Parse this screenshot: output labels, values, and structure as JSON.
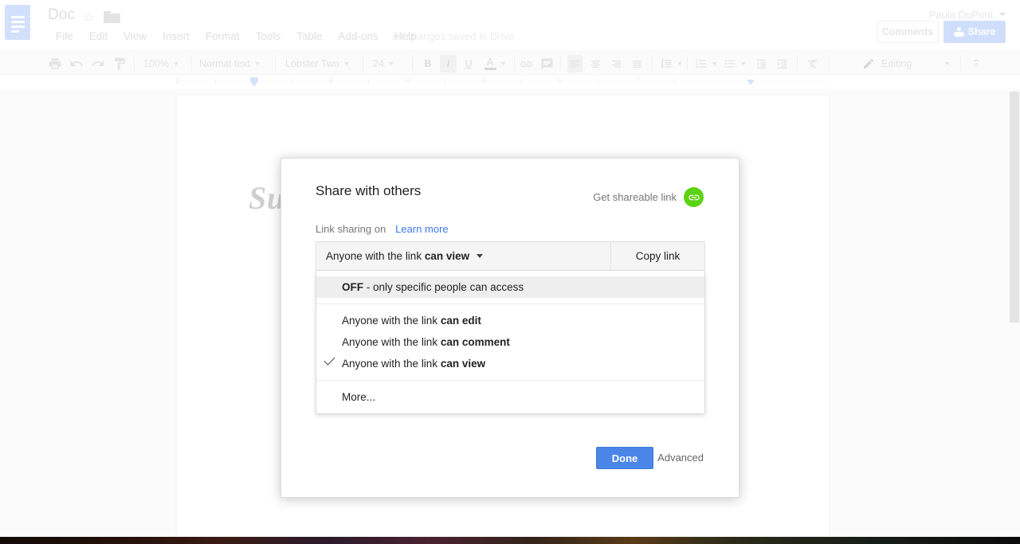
{
  "app": {
    "doc_title": "Doc",
    "account_name": "Paula DuPont",
    "save_status": "All changes saved in Drive",
    "comments_label": "Comments",
    "share_label": "Share"
  },
  "menubar": {
    "items": [
      "File",
      "Edit",
      "View",
      "Insert",
      "Format",
      "Tools",
      "Table",
      "Add-ons",
      "Help"
    ]
  },
  "toolbar": {
    "zoom": "100%",
    "style": "Normal text",
    "font": "Lobster Two",
    "font_size": "24",
    "bold": "B",
    "italic": "I",
    "underline": "U",
    "text_color": "A",
    "mode": "Editing"
  },
  "ruler": {
    "numbers": [
      "1",
      "2",
      "3",
      "4",
      "5",
      "6",
      "7"
    ]
  },
  "document": {
    "heading_visible_text": "Su"
  },
  "modal": {
    "title": "Share with others",
    "get_shareable_link": "Get shareable link",
    "link_sharing_label": "Link sharing on",
    "learn_more": "Learn more",
    "selected_option_prefix": "Anyone with the link ",
    "selected_option_strong": "can view",
    "copy_link": "Copy link",
    "done": "Done",
    "advanced": "Advanced",
    "dropdown": {
      "groups": [
        {
          "items": [
            {
              "strong": "OFF",
              "rest": " - only specific people can access",
              "checked": false,
              "highlighted": true
            }
          ]
        },
        {
          "items": [
            {
              "prefix": "Anyone with the link ",
              "strong": "can edit",
              "checked": false,
              "highlighted": false
            },
            {
              "prefix": "Anyone with the link ",
              "strong": "can comment",
              "checked": false,
              "highlighted": false
            },
            {
              "prefix": "Anyone with the link ",
              "strong": "can view",
              "checked": true,
              "highlighted": false
            }
          ]
        },
        {
          "items": [
            {
              "prefix": "More...",
              "strong": "",
              "checked": false,
              "highlighted": false
            }
          ]
        }
      ]
    }
  },
  "colors": {
    "accent_blue": "#4a86e8",
    "link_blue": "#3b78e7",
    "link_badge_green": "#5cd312",
    "share_button": "#cfdffb",
    "logo_blue": "#d2e0fb"
  }
}
